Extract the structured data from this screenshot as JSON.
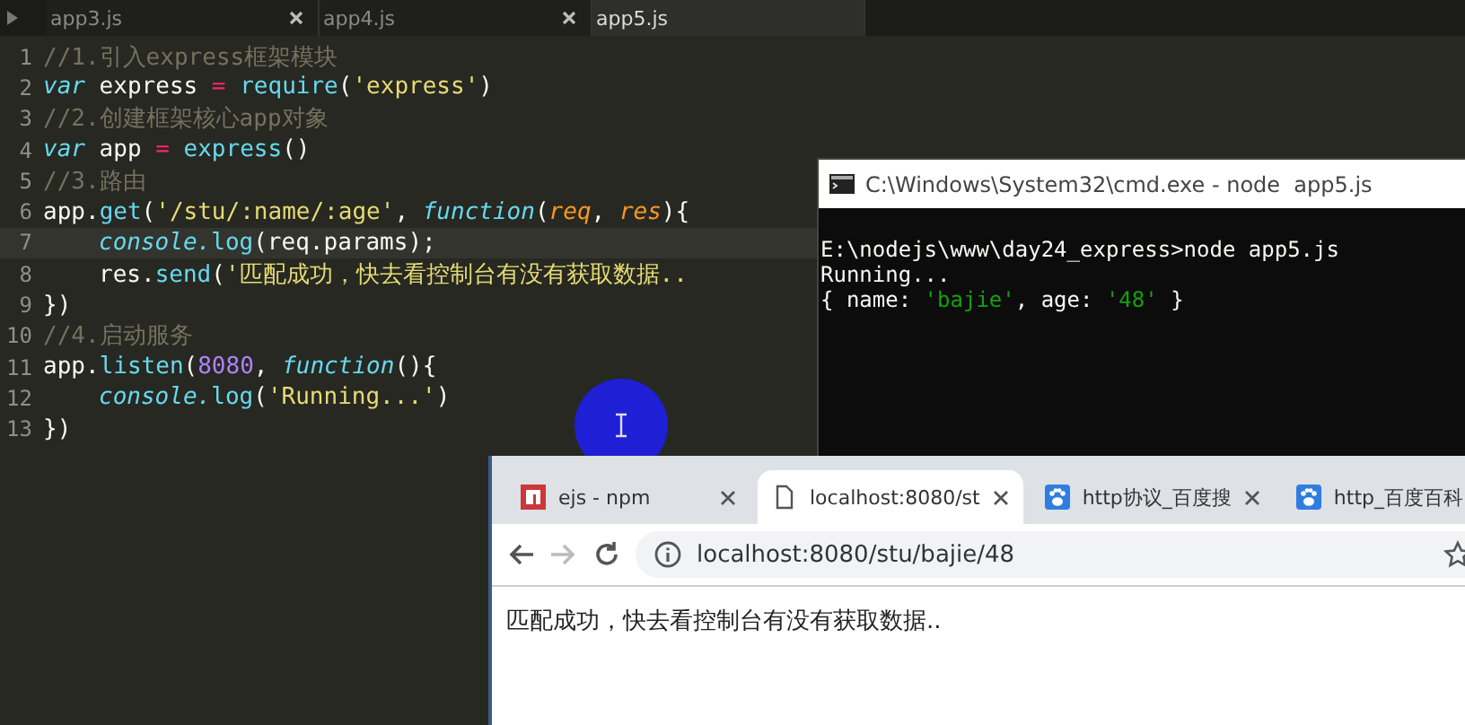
{
  "editor": {
    "tabs": [
      {
        "label": "app3.js",
        "selected": false,
        "closable": true
      },
      {
        "label": "app4.js",
        "selected": false,
        "closable": true
      },
      {
        "label": "app5.js",
        "selected": true,
        "closable": false
      }
    ],
    "lines": [
      {
        "number": "1",
        "current": false,
        "indented": false,
        "tokens": [
          {
            "text": "//1.引入express框架模块",
            "kind": "comment"
          }
        ]
      },
      {
        "number": "2",
        "current": false,
        "indented": false,
        "tokens": [
          {
            "text": "var",
            "kind": "keyword"
          },
          {
            "text": " express",
            "kind": "plain"
          },
          {
            "text": " = ",
            "kind": "operator"
          },
          {
            "text": "require",
            "kind": "func"
          },
          {
            "text": "(",
            "kind": "plain"
          },
          {
            "text": "'express'",
            "kind": "string"
          },
          {
            "text": ")",
            "kind": "plain"
          }
        ]
      },
      {
        "number": "3",
        "current": false,
        "indented": false,
        "tokens": [
          {
            "text": "//2.创建框架核心app对象",
            "kind": "comment"
          }
        ]
      },
      {
        "number": "4",
        "current": false,
        "indented": false,
        "tokens": [
          {
            "text": "var",
            "kind": "keyword"
          },
          {
            "text": " app",
            "kind": "plain"
          },
          {
            "text": " = ",
            "kind": "operator"
          },
          {
            "text": "express",
            "kind": "func"
          },
          {
            "text": "()",
            "kind": "plain"
          }
        ]
      },
      {
        "number": "5",
        "current": false,
        "indented": false,
        "tokens": [
          {
            "text": "//3.路由",
            "kind": "comment"
          }
        ]
      },
      {
        "number": "6",
        "current": false,
        "indented": false,
        "tokens": [
          {
            "text": "app.",
            "kind": "plain"
          },
          {
            "text": "get",
            "kind": "func"
          },
          {
            "text": "(",
            "kind": "plain"
          },
          {
            "text": "'/stu/:name/:age'",
            "kind": "string"
          },
          {
            "text": ", ",
            "kind": "plain"
          },
          {
            "text": "function",
            "kind": "keyword"
          },
          {
            "text": "(",
            "kind": "plain"
          },
          {
            "text": "req",
            "kind": "param"
          },
          {
            "text": ", ",
            "kind": "plain"
          },
          {
            "text": "res",
            "kind": "param"
          },
          {
            "text": "){",
            "kind": "plain"
          }
        ]
      },
      {
        "number": "7",
        "current": true,
        "indented": true,
        "tokens": [
          {
            "text": "console.",
            "kind": "keyword"
          },
          {
            "text": "log",
            "kind": "func"
          },
          {
            "text": "(req.params);",
            "kind": "plain"
          }
        ]
      },
      {
        "number": "8",
        "current": false,
        "indented": true,
        "tokens": [
          {
            "text": "res.",
            "kind": "plain"
          },
          {
            "text": "send",
            "kind": "func"
          },
          {
            "text": "(",
            "kind": "plain"
          },
          {
            "text": "'匹配成功，快去看控制台有没有获取数据..",
            "kind": "string"
          }
        ]
      },
      {
        "number": "9",
        "current": false,
        "indented": false,
        "tokens": [
          {
            "text": "})",
            "kind": "plain"
          }
        ]
      },
      {
        "number": "10",
        "current": false,
        "indented": false,
        "tokens": [
          {
            "text": "//4.启动服务",
            "kind": "comment"
          }
        ]
      },
      {
        "number": "11",
        "current": false,
        "indented": false,
        "tokens": [
          {
            "text": "app.",
            "kind": "plain"
          },
          {
            "text": "listen",
            "kind": "func"
          },
          {
            "text": "(",
            "kind": "plain"
          },
          {
            "text": "8080",
            "kind": "number"
          },
          {
            "text": ", ",
            "kind": "plain"
          },
          {
            "text": "function",
            "kind": "keyword"
          },
          {
            "text": "(){",
            "kind": "plain"
          }
        ]
      },
      {
        "number": "12",
        "current": false,
        "indented": true,
        "tokens": [
          {
            "text": "console.",
            "kind": "keyword"
          },
          {
            "text": "log",
            "kind": "func"
          },
          {
            "text": "(",
            "kind": "plain"
          },
          {
            "text": "'Running...'",
            "kind": "string"
          },
          {
            "text": ")",
            "kind": "plain"
          }
        ]
      },
      {
        "number": "13",
        "current": false,
        "indented": false,
        "tokens": [
          {
            "text": "})",
            "kind": "plain"
          }
        ]
      }
    ]
  },
  "console_window": {
    "title": "C:\\Windows\\System32\\cmd.exe - node  app5.js",
    "lines": [
      [
        {
          "text": "E:\\nodejs\\www\\day24_express>node app5.js",
          "kind": "plain"
        }
      ],
      [
        {
          "text": "Running...",
          "kind": "plain"
        }
      ],
      [
        {
          "text": "{ name: ",
          "kind": "plain"
        },
        {
          "text": "'bajie'",
          "kind": "string"
        },
        {
          "text": ", age: ",
          "kind": "plain"
        },
        {
          "text": "'48'",
          "kind": "string"
        },
        {
          "text": " }",
          "kind": "plain"
        }
      ]
    ]
  },
  "browser": {
    "tabs": [
      {
        "label": "ejs - npm",
        "selected": false
      },
      {
        "label": "localhost:8080/st",
        "selected": true
      },
      {
        "label": "http协议_百度搜",
        "selected": false
      },
      {
        "label": "http_百度百科",
        "selected": false
      }
    ],
    "nav": [
      {
        "kind": "back",
        "disabled": false
      },
      {
        "kind": "forward",
        "disabled": true
      },
      {
        "kind": "reload",
        "disabled": false
      }
    ],
    "address": "localhost:8080/stu/bajie/48",
    "content": "匹配成功，快去看控制台有没有获取数据.."
  }
}
